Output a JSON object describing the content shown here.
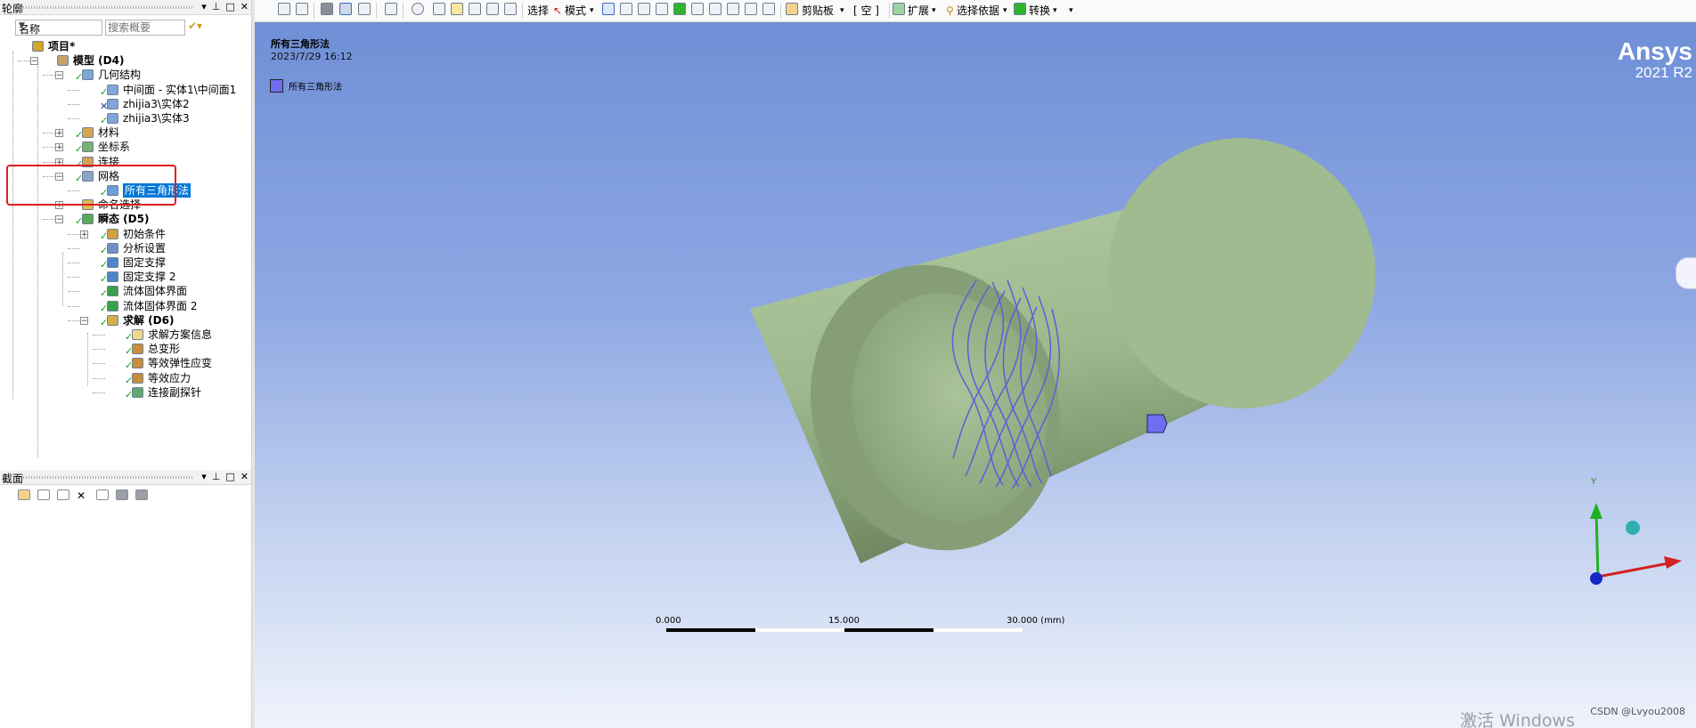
{
  "outline_panel": {
    "title": "轮廓",
    "pin": "ᵖ",
    "filter_field": "名称",
    "search_placeholder": "搜索概要"
  },
  "tree": [
    {
      "label": "项目*",
      "bold": true,
      "icon": "project-icon",
      "status": "none"
    },
    {
      "label": "模型 (D4)",
      "bold": true,
      "icon": "model-icon",
      "status": "none"
    },
    {
      "label": "几何结构",
      "icon": "geometry-icon",
      "status": "check"
    },
    {
      "label": "中间面 - 实体1\\中间面1",
      "icon": "surface-body-icon",
      "status": "check"
    },
    {
      "label": "zhijia3\\实体2",
      "icon": "solid-body-icon",
      "status": "cross"
    },
    {
      "label": "zhijia3\\实体3",
      "icon": "solid-body-icon",
      "status": "check"
    },
    {
      "label": "材料",
      "icon": "materials-icon",
      "status": "check"
    },
    {
      "label": "坐标系",
      "icon": "coordinate-system-icon",
      "status": "check"
    },
    {
      "label": "连接",
      "icon": "connections-icon",
      "status": "check"
    },
    {
      "label": "网格",
      "icon": "mesh-icon",
      "status": "check"
    },
    {
      "label": "所有三角形法",
      "icon": "mesh-method-icon",
      "status": "check",
      "selected": true
    },
    {
      "label": "命名选择",
      "icon": "named-selection-icon",
      "status": "none"
    },
    {
      "label": "瞬态 (D5)",
      "bold": true,
      "icon": "transient-icon",
      "status": "check"
    },
    {
      "label": "初始条件",
      "icon": "initial-conditions-icon",
      "status": "check"
    },
    {
      "label": "分析设置",
      "icon": "analysis-settings-icon",
      "status": "check"
    },
    {
      "label": "固定支撑",
      "icon": "fixed-support-icon",
      "status": "check"
    },
    {
      "label": "固定支撑 2",
      "icon": "fixed-support-icon",
      "status": "check"
    },
    {
      "label": "流体固体界面",
      "icon": "fsi-icon",
      "status": "check"
    },
    {
      "label": "流体固体界面 2",
      "icon": "fsi-icon",
      "status": "check"
    },
    {
      "label": "求解 (D6)",
      "bold": true,
      "icon": "solution-icon",
      "status": "check"
    },
    {
      "label": "求解方案信息",
      "icon": "solution-info-icon",
      "status": "check"
    },
    {
      "label": "总变形",
      "icon": "total-deformation-icon",
      "status": "check"
    },
    {
      "label": "等效弹性应变",
      "icon": "equivalent-strain-icon",
      "status": "check"
    },
    {
      "label": "等效应力",
      "icon": "equivalent-stress-icon",
      "status": "check"
    },
    {
      "label": "连接副探针",
      "icon": "joint-probe-icon",
      "status": "check"
    }
  ],
  "section_panel": {
    "title": "截面"
  },
  "toolbar": {
    "select_label": "选择",
    "mode_label": "模式",
    "clipboard_label": "剪贴板",
    "empty_label": "[ 空 ]",
    "extend_label": "扩展",
    "select_by_label": "选择依据",
    "convert_label": "转换",
    "select_mode_glyph": "↖"
  },
  "viewport": {
    "title": "所有三角形法",
    "date": "2023/7/29 16:12",
    "legend_label": "所有三角形法",
    "legend_color": "#6f6ef3",
    "body_color": "#a6c296",
    "mesh_color": "#5b5fd8"
  },
  "branding": {
    "product": "Ansys",
    "version": "2021 R2"
  },
  "scale": {
    "labels": [
      "0.000",
      "15.000",
      "30.000 (mm)"
    ]
  },
  "triad": {
    "y_label": "Y"
  },
  "watermark": "激活 Windows",
  "csdn": "CSDN @Lvyou2008"
}
